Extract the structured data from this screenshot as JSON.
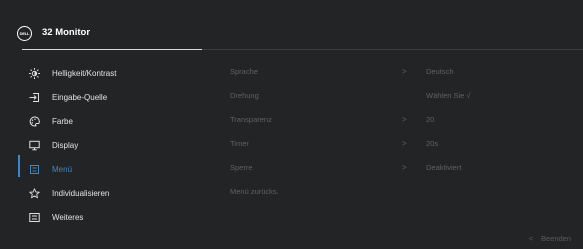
{
  "header": {
    "logo_text": "DELL",
    "title": "32 Monitor"
  },
  "menu": {
    "items": [
      {
        "label": "Helligkeit/Kontrast",
        "icon": "brightness-icon"
      },
      {
        "label": "Eingabe-Quelle",
        "icon": "input-source-icon"
      },
      {
        "label": "Farbe",
        "icon": "color-palette-icon"
      },
      {
        "label": "Display",
        "icon": "display-monitor-icon"
      },
      {
        "label": "Menü",
        "icon": "menu-icon",
        "selected": true
      },
      {
        "label": "Individualisieren",
        "icon": "star-icon"
      },
      {
        "label": "Weiteres",
        "icon": "others-icon"
      }
    ]
  },
  "submenu": {
    "rows": [
      {
        "label": "Sprache",
        "chevron": ">",
        "value": "Deutsch"
      },
      {
        "label": "Drehung",
        "chevron": "",
        "value": "Wählen Sie √"
      },
      {
        "label": "Transparenz",
        "chevron": ">",
        "value": "20"
      },
      {
        "label": "Timer",
        "chevron": ">",
        "value": "20s"
      },
      {
        "label": "Sperre",
        "chevron": ">",
        "value": "Deaktiviert"
      },
      {
        "label": "Menü zurücks.",
        "chevron": "",
        "value": ""
      }
    ]
  },
  "footer": {
    "exit_chevron": "<",
    "exit_label": "Beenden"
  },
  "colors": {
    "background": "#222426",
    "accent": "#3c89c9",
    "inactive_text": "#5f6163"
  }
}
